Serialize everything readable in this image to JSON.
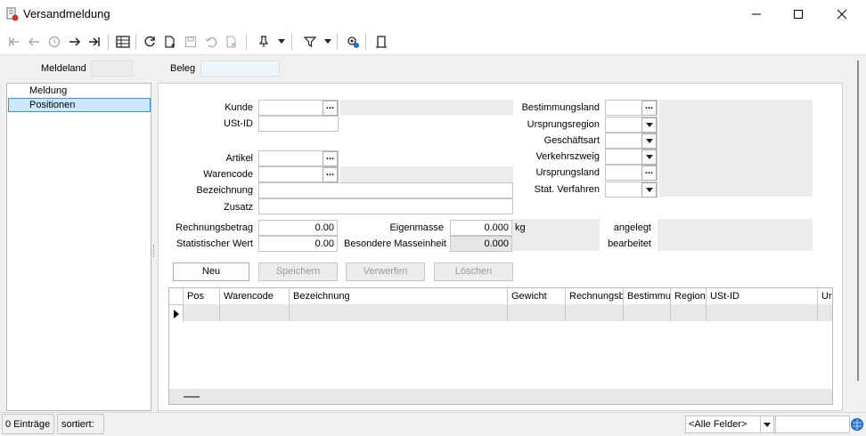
{
  "window": {
    "title": "Versandmeldung"
  },
  "filter_bar": {
    "meldeland_label": "Meldeland",
    "beleg_label": "Beleg"
  },
  "tree": {
    "items": [
      "Meldung",
      "Positionen"
    ]
  },
  "form": {
    "kunde": "Kunde",
    "ustid": "USt-ID",
    "artikel": "Artikel",
    "warencode": "Warencode",
    "bezeichnung": "Bezeichnung",
    "zusatz": "Zusatz",
    "bestimmungsland": "Bestimmungsland",
    "ursprungsregion": "Ursprungsregion",
    "geschaeftsart": "Geschäftsart",
    "verkehrszweig": "Verkehrszweig",
    "ursprungsland": "Ursprungsland",
    "stat_verfahren": "Stat. Verfahren",
    "rechnungsbetrag_label": "Rechnungsbetrag",
    "rechnungsbetrag_value": "0.00",
    "statwert_label": "Statistischer Wert",
    "statwert_value": "0.00",
    "eigenmasse_label": "Eigenmasse",
    "eigenmasse_value": "0.000",
    "kg": "kg",
    "bes_masse_label": "Besondere Masseinheit",
    "bes_masse_value": "0.000",
    "angelegt": "angelegt",
    "bearbeitet": "bearbeitet",
    "dots": "..."
  },
  "buttons": {
    "neu": "Neu",
    "speichern": "Speichern",
    "verwerfen": "Verwerfen",
    "loeschen": "Löschen"
  },
  "grid": {
    "columns": [
      "Pos",
      "Warencode",
      "Bezeichnung",
      "Gewicht",
      "Rechnungsbetrag",
      "Bestimmungsland",
      "Region",
      "USt-ID",
      "Ursprungsland"
    ]
  },
  "status": {
    "count": "0 Einträge",
    "sorted": "sortiert:",
    "field_filter": "<Alle Felder>"
  }
}
